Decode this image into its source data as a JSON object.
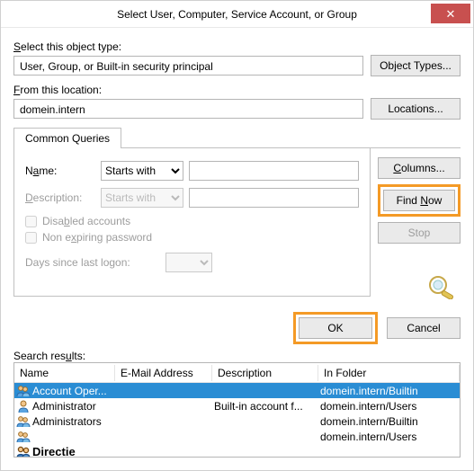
{
  "window": {
    "title": "Select User, Computer, Service Account, or Group"
  },
  "objectType": {
    "label": "Select this object type:",
    "value": "User, Group, or Built-in security principal",
    "button": "Object Types..."
  },
  "location": {
    "label": "From this location:",
    "value": "domein.intern",
    "button": "Locations..."
  },
  "tabs": {
    "commonQueries": "Common Queries"
  },
  "query": {
    "nameLabel": "Name:",
    "descLabel": "Description:",
    "startsWith": "Starts with",
    "disabledAccounts": "Disabled accounts",
    "nonExpiring": "Non expiring password",
    "daysSince": "Days since last logon:"
  },
  "side": {
    "columns": "Columns...",
    "findNow": "Find Now",
    "stop": "Stop"
  },
  "okcancel": {
    "ok": "OK",
    "cancel": "Cancel"
  },
  "results": {
    "label": "Search results:",
    "headers": {
      "name": "Name",
      "email": "E-Mail Address",
      "desc": "Description",
      "folder": "In Folder"
    },
    "rows": [
      {
        "icon": "group",
        "name": "Account Oper...",
        "email": "",
        "desc": "",
        "folder": "domein.intern/Builtin",
        "selected": true
      },
      {
        "icon": "user",
        "name": "Administrator",
        "email": "",
        "desc": "Built-in account f...",
        "folder": "domein.intern/Users"
      },
      {
        "icon": "group",
        "name": "Administrators",
        "email": "",
        "desc": "",
        "folder": "domein.intern/Builtin"
      },
      {
        "icon": "group",
        "name": "",
        "email": "",
        "desc": "",
        "folder": "domein.intern/Users"
      },
      {
        "icon": "group-bold",
        "name": "Directie",
        "email": "",
        "desc": "",
        "folder": ""
      }
    ]
  }
}
